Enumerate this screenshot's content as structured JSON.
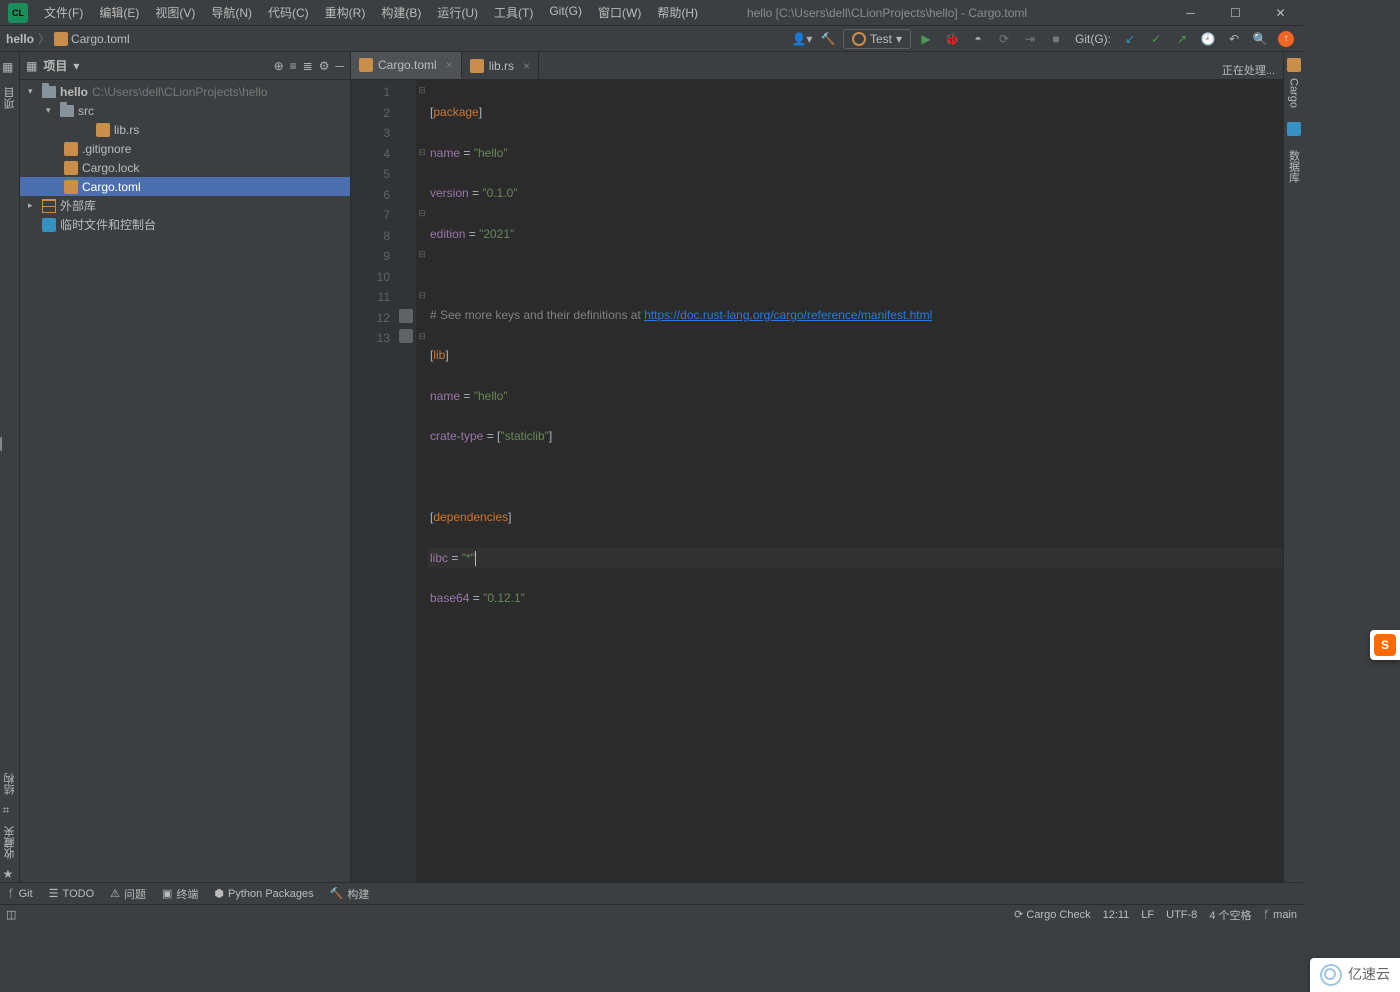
{
  "window": {
    "title": "hello [C:\\Users\\dell\\CLionProjects\\hello] - Cargo.toml"
  },
  "menu": {
    "file": "文件(F)",
    "edit": "编辑(E)",
    "view": "视图(V)",
    "navigate": "导航(N)",
    "code": "代码(C)",
    "refactor": "重构(R)",
    "build": "构建(B)",
    "run": "运行(U)",
    "tools": "工具(T)",
    "git": "Git(G)",
    "window": "窗口(W)",
    "help": "帮助(H)"
  },
  "breadcrumb": {
    "root": "hello",
    "file": "Cargo.toml"
  },
  "runConfig": "Test",
  "gitLabel": "Git(G):",
  "projectPane": {
    "title": "项目",
    "rootName": "hello",
    "rootPath": "C:\\Users\\dell\\CLionProjects\\hello",
    "src": "src",
    "librs": "lib.rs",
    "gitignore": ".gitignore",
    "cargolock": "Cargo.lock",
    "cargotoml": "Cargo.toml",
    "external": "外部库",
    "scratches": "临时文件和控制台"
  },
  "tabs": {
    "cargo": "Cargo.toml",
    "librs": "lib.rs"
  },
  "rightStatus": "正在处理...",
  "leftGutter": {
    "project": "项目",
    "structure": "结构",
    "favorites": "收藏夹"
  },
  "rightGutter": {
    "cargo": "Cargo",
    "database": "数据库"
  },
  "code": {
    "lines": [
      1,
      2,
      3,
      4,
      5,
      6,
      7,
      8,
      9,
      10,
      11,
      12,
      13
    ],
    "l1_a": "[",
    "l1_b": "package",
    "l1_c": "]",
    "l2_a": "name",
    "l2_b": " = ",
    "l2_c": "\"hello\"",
    "l3_a": "version",
    "l3_b": " = ",
    "l3_c": "\"0.1.0\"",
    "l4_a": "edition",
    "l4_b": " = ",
    "l4_c": "\"2021\"",
    "l6_a": "# See more keys and their definitions at ",
    "l6_b": "https://doc.rust-lang.org/cargo/reference/manifest.html",
    "l7_a": "[",
    "l7_b": "lib",
    "l7_c": "]",
    "l8_a": "name",
    "l8_b": " = ",
    "l8_c": "\"hello\"",
    "l9_a": "crate-type",
    "l9_b": " = [",
    "l9_c": "\"staticlib\"",
    "l9_d": "]",
    "l11_a": "[",
    "l11_b": "dependencies",
    "l11_c": "]",
    "l12_a": "libc",
    "l12_b": " = ",
    "l12_c": "\"*\"",
    "l13_a": "base64",
    "l13_b": " = ",
    "l13_c": "\"0.12.1\""
  },
  "toolwindows": {
    "git": "Git",
    "todo": "TODO",
    "problems": "问题",
    "terminal": "终端",
    "python": "Python Packages",
    "build": "构建"
  },
  "statusbar": {
    "cargoCheck": "Cargo Check",
    "pos": "12:11",
    "sep": "LF",
    "encoding": "UTF-8",
    "spaces": "4 个空格",
    "branch": "main"
  },
  "overlay2": "亿速云"
}
